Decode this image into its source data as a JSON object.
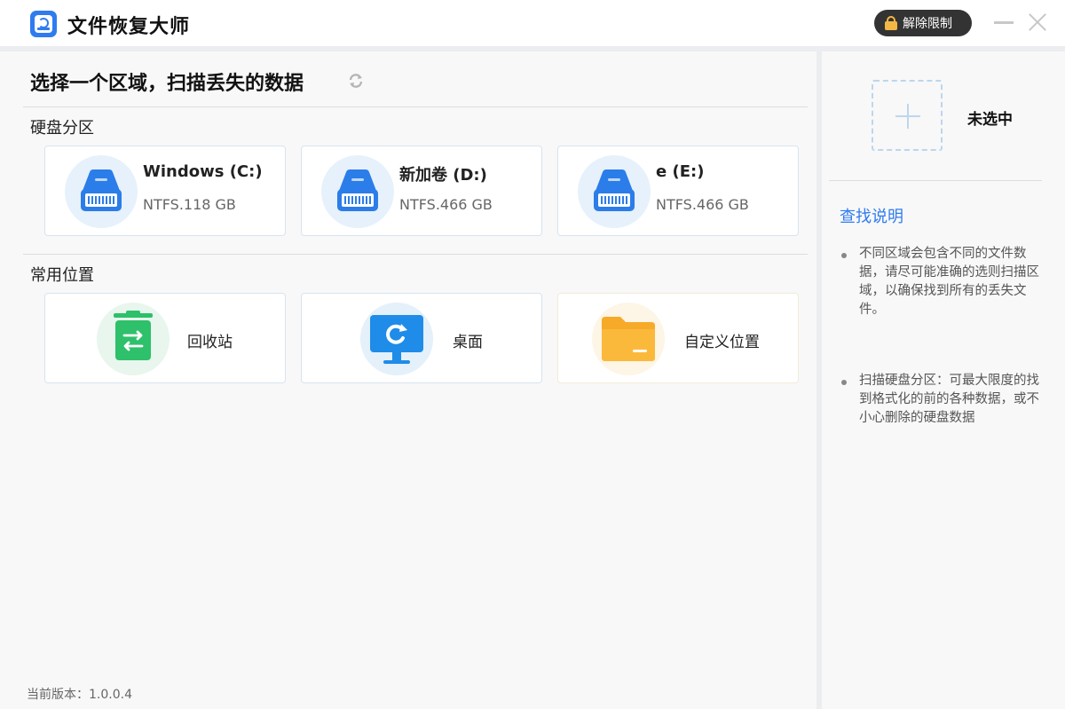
{
  "app": {
    "title": "文件恢复大师",
    "unlock_label": "解除限制"
  },
  "main": {
    "title": "选择一个区域，扫描丢失的数据",
    "disk_section": "硬盘分区",
    "drives": [
      {
        "name": "Windows (C:)",
        "info": "NTFS.118 GB"
      },
      {
        "name": "新加卷 (D:)",
        "info": "NTFS.466 GB"
      },
      {
        "name": "e (E:)",
        "info": "NTFS.466 GB"
      }
    ],
    "common_section": "常用位置",
    "locations": [
      {
        "label": "回收站",
        "icon": "recycle-bin-icon"
      },
      {
        "label": "桌面",
        "icon": "desktop-icon"
      },
      {
        "label": "自定义位置",
        "icon": "folder-icon"
      }
    ],
    "version": "当前版本：1.0.0.4"
  },
  "side": {
    "selection": "未选中",
    "help_title": "查找说明",
    "tips": [
      "不同区域会包含不同的文件数据，请尽可能准确的选则扫描区域，以确保找到所有的丢失文件。",
      "扫描硬盘分区：可最大限度的找到格式化的前的各种数据，或不小心删除的硬盘数据"
    ]
  },
  "colors": {
    "accent": "#2f7bf0",
    "drive_icon": "#2b7de9",
    "recycle_green": "#2ec06a",
    "desktop_blue": "#1e8ce8",
    "folder_orange": "#f7a928",
    "unlock_bg": "#333333"
  }
}
